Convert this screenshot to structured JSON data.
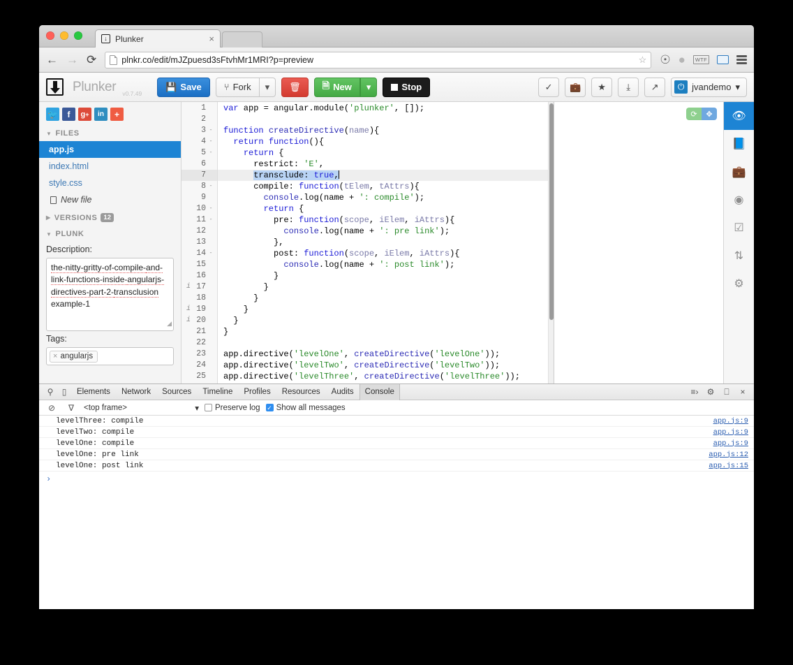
{
  "browser": {
    "tab_title": "Plunker",
    "tab_close": "×",
    "back_icon": "←",
    "forward_icon": "→",
    "reload_icon": "⟳",
    "url": "plnkr.co/edit/mJZpuesd3sFtvhMr1MRI?p=preview",
    "star_icon": "☆",
    "ext_icons": [
      "◔",
      "●",
      "WTF",
      "screen",
      "menu"
    ]
  },
  "toolbar": {
    "brand": "Plunker",
    "version": "v0.7.49",
    "save_label": "Save",
    "save_icon": "💾",
    "fork_label": "Fork",
    "fork_icon": "⑂",
    "fork_caret": "▾",
    "delete_icon": "🗑",
    "new_label": "New",
    "new_icon": "🗎",
    "new_caret": "▾",
    "stop_label": "Stop",
    "right_icons": [
      {
        "name": "check-icon",
        "glyph": "✓"
      },
      {
        "name": "briefcase-icon",
        "glyph": "💼"
      },
      {
        "name": "star-icon",
        "glyph": "★"
      },
      {
        "name": "download-icon",
        "glyph": "⤓"
      },
      {
        "name": "external-link-icon",
        "glyph": "↗"
      }
    ],
    "user_name": "jvandemo",
    "user_caret": "▾",
    "user_avatar_glyph": "⏻"
  },
  "sidebar": {
    "social": [
      {
        "name": "twitter",
        "glyph": "𝐓",
        "color": "#2fa3e0"
      },
      {
        "name": "facebook",
        "glyph": "f",
        "color": "#3b5998"
      },
      {
        "name": "google-plus",
        "glyph": "g⁺",
        "color": "#dd4b39"
      },
      {
        "name": "linkedin",
        "glyph": "in",
        "color": "#2f8ec0"
      },
      {
        "name": "more",
        "glyph": "+",
        "color": "#ef5c42"
      }
    ],
    "files_header": "FILES",
    "files": [
      {
        "name": "app.js",
        "active": true
      },
      {
        "name": "index.html",
        "active": false
      },
      {
        "name": "style.css",
        "active": false
      }
    ],
    "new_file_label": "New file",
    "versions_header": "VERSIONS",
    "versions_count": "12",
    "plunk_header": "PLUNK",
    "description_label": "Description:",
    "description_parts": [
      {
        "text": "the-nitty-gritty-of-compile-",
        "spell": true
      },
      {
        "text": "and-link-functions-inside-",
        "spell": true
      },
      {
        "text": "angularjs-directives-part-2-",
        "spell": true
      },
      {
        "text": "transclusion",
        "spell": true
      },
      {
        "text": " example-1",
        "spell": false
      }
    ],
    "tags_label": "Tags:",
    "tags": [
      {
        "label": "angularjs",
        "remove": "×"
      }
    ]
  },
  "editor": {
    "lines": [
      {
        "n": "1",
        "fold": "",
        "info": false,
        "hi": false,
        "html": "<span class='kw'>var</span> app = angular.module(<span class='str'>'plunker'</span>, []);"
      },
      {
        "n": "2",
        "fold": "",
        "info": false,
        "hi": false,
        "html": ""
      },
      {
        "n": "3",
        "fold": "-",
        "info": false,
        "hi": false,
        "html": "<span class='kw'>function</span> <span class='fn'>createDirective</span>(<span class='param'>name</span>){"
      },
      {
        "n": "4",
        "fold": "-",
        "info": false,
        "hi": false,
        "html": "  <span class='kw'>return</span> <span class='kw'>function</span>(){"
      },
      {
        "n": "5",
        "fold": "-",
        "info": false,
        "hi": false,
        "html": "    <span class='kw'>return</span> {"
      },
      {
        "n": "6",
        "fold": "",
        "info": false,
        "hi": false,
        "html": "      restrict: <span class='str'>'E'</span>,"
      },
      {
        "n": "7",
        "fold": "",
        "info": false,
        "hi": true,
        "html": "      <span class='sel'>transclude: <span class='kw'>true</span>,</span><span class='caret'></span>"
      },
      {
        "n": "8",
        "fold": "-",
        "info": false,
        "hi": false,
        "html": "      compile: <span class='kw'>function</span>(<span class='param'>tElem</span>, <span class='param'>tAttrs</span>){"
      },
      {
        "n": "9",
        "fold": "",
        "info": false,
        "hi": false,
        "html": "        <span class='fn'>console</span>.log(name + <span class='str'>': compile'</span>);"
      },
      {
        "n": "10",
        "fold": "-",
        "info": false,
        "hi": false,
        "html": "        <span class='kw'>return</span> {"
      },
      {
        "n": "11",
        "fold": "-",
        "info": false,
        "hi": false,
        "html": "          pre: <span class='kw'>function</span>(<span class='param'>scope</span>, <span class='param'>iElem</span>, <span class='param'>iAttrs</span>){"
      },
      {
        "n": "12",
        "fold": "",
        "info": false,
        "hi": false,
        "html": "            <span class='fn'>console</span>.log(name + <span class='str'>': pre link'</span>);"
      },
      {
        "n": "13",
        "fold": "",
        "info": false,
        "hi": false,
        "html": "          },"
      },
      {
        "n": "14",
        "fold": "-",
        "info": false,
        "hi": false,
        "html": "          post: <span class='kw'>function</span>(<span class='param'>scope</span>, <span class='param'>iElem</span>, <span class='param'>iAttrs</span>){"
      },
      {
        "n": "15",
        "fold": "",
        "info": false,
        "hi": false,
        "html": "            <span class='fn'>console</span>.log(name + <span class='str'>': post link'</span>);"
      },
      {
        "n": "16",
        "fold": "",
        "info": false,
        "hi": false,
        "html": "          }"
      },
      {
        "n": "17",
        "fold": "",
        "info": true,
        "hi": false,
        "html": "        }"
      },
      {
        "n": "18",
        "fold": "",
        "info": false,
        "hi": false,
        "html": "      }"
      },
      {
        "n": "19",
        "fold": "",
        "info": true,
        "hi": false,
        "html": "    }"
      },
      {
        "n": "20",
        "fold": "",
        "info": true,
        "hi": false,
        "html": "  }"
      },
      {
        "n": "21",
        "fold": "",
        "info": false,
        "hi": false,
        "html": "}"
      },
      {
        "n": "22",
        "fold": "",
        "info": false,
        "hi": false,
        "html": ""
      },
      {
        "n": "23",
        "fold": "",
        "info": false,
        "hi": false,
        "html": "app.directive(<span class='str'>'levelOne'</span>, <span class='fn'>createDirective</span>(<span class='str'>'levelOne'</span>));"
      },
      {
        "n": "24",
        "fold": "",
        "info": false,
        "hi": false,
        "html": "app.directive(<span class='str'>'levelTwo'</span>, <span class='fn'>createDirective</span>(<span class='str'>'levelTwo'</span>));"
      },
      {
        "n": "25",
        "fold": "",
        "info": false,
        "hi": false,
        "html": "app.directive(<span class='str'>'levelThree'</span>, <span class='fn'>createDirective</span>(<span class='str'>'levelThree'</span>));"
      }
    ]
  },
  "preview": {
    "refresh_icon": "⟳",
    "expand_icon": "✥"
  },
  "right_rail": [
    {
      "name": "preview-eye-icon",
      "glyph": "◉",
      "active": true
    },
    {
      "name": "docs-book-icon",
      "glyph": "◧",
      "active": false
    },
    {
      "name": "briefcase-icon",
      "glyph": "💼",
      "active": false
    },
    {
      "name": "dashboard-icon",
      "glyph": "◔",
      "active": false
    },
    {
      "name": "checklist-icon",
      "glyph": "☑",
      "active": false
    },
    {
      "name": "sync-icon",
      "glyph": "⇅",
      "active": false
    },
    {
      "name": "settings-gear-icon",
      "glyph": "⚙",
      "active": false
    }
  ],
  "devtools": {
    "search_icon": "⚲",
    "device_icon": "▯",
    "tabs": [
      {
        "label": "Elements",
        "active": false
      },
      {
        "label": "Network",
        "active": false
      },
      {
        "label": "Sources",
        "active": false
      },
      {
        "label": "Timeline",
        "active": false
      },
      {
        "label": "Profiles",
        "active": false
      },
      {
        "label": "Resources",
        "active": false
      },
      {
        "label": "Audits",
        "active": false
      },
      {
        "label": "Console",
        "active": true
      }
    ],
    "right_icons": [
      {
        "name": "drawer-toggle-icon",
        "glyph": "⌫"
      },
      {
        "name": "devtools-settings-icon",
        "glyph": "⚙"
      },
      {
        "name": "dock-side-icon",
        "glyph": "❐"
      },
      {
        "name": "close-icon",
        "glyph": "×"
      }
    ],
    "clear_icon": "⊘",
    "filter_icon": "∇",
    "frame_label": "<top frame>",
    "frame_caret": "▾",
    "preserve_log_label": "Preserve log",
    "preserve_log_checked": false,
    "show_all_label": "Show all messages",
    "show_all_checked": true,
    "messages": [
      {
        "text": "levelThree: compile",
        "source": "app.js:9"
      },
      {
        "text": "levelTwo: compile",
        "source": "app.js:9"
      },
      {
        "text": "levelOne: compile",
        "source": "app.js:9"
      },
      {
        "text": "levelOne: pre link",
        "source": "app.js:12"
      },
      {
        "text": "levelOne: post link",
        "source": "app.js:15"
      }
    ],
    "prompt": "›"
  }
}
